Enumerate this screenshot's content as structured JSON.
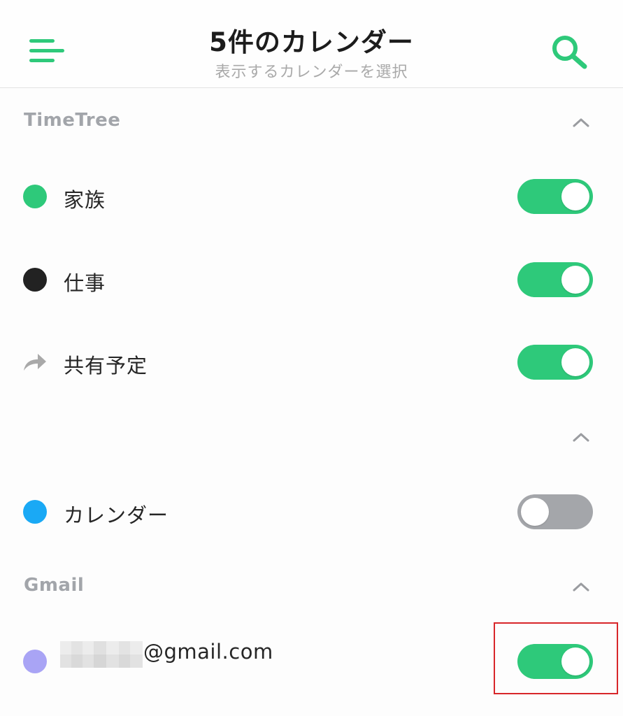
{
  "header": {
    "title": "5件のカレンダー",
    "subtitle": "表示するカレンダーを選択",
    "menu_icon": "hamburger-menu-icon",
    "search_icon": "search-icon"
  },
  "sections": [
    {
      "title": "TimeTree",
      "expanded": true,
      "items": [
        {
          "label": "家族",
          "color": "#2ec97a",
          "icon": "color-dot",
          "enabled": true
        },
        {
          "label": "仕事",
          "color": "#222222",
          "icon": "color-dot",
          "enabled": true
        },
        {
          "label": "共有予定",
          "color": "#a9a9a9",
          "icon": "share-arrow-icon",
          "enabled": true
        }
      ]
    },
    {
      "title": "",
      "expanded": true,
      "items": [
        {
          "label": "カレンダー",
          "color": "#1aa9f5",
          "icon": "color-dot",
          "enabled": false
        }
      ]
    },
    {
      "title": "Gmail",
      "expanded": true,
      "items": [
        {
          "label": "@gmail.com",
          "color": "#a9a4f5",
          "icon": "color-dot",
          "enabled": true
        }
      ]
    }
  ],
  "colors": {
    "accent": "#2ec97a",
    "toggle_off": "#a4a6aa",
    "highlight": "#d8262a",
    "section_title": "#a2a5aa"
  }
}
